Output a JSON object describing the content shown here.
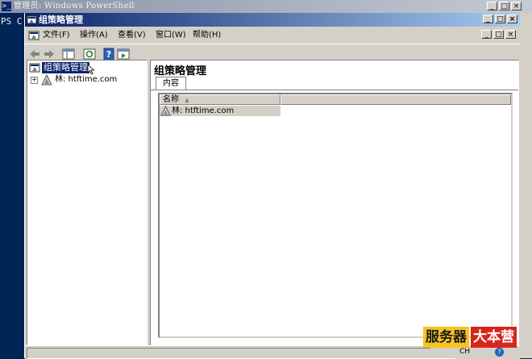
{
  "background_window": {
    "title": "管理员: Windows PowerShell",
    "prompt": "PS C"
  },
  "window": {
    "title": "组策略管理",
    "controls": [
      "_",
      "□",
      "×"
    ]
  },
  "menu": {
    "items": [
      "文件(F)",
      "操作(A)",
      "查看(V)",
      "窗口(W)",
      "帮助(H)"
    ],
    "mdi_controls": [
      "_",
      "□",
      "×"
    ]
  },
  "toolbar": {
    "icons": [
      "back-icon",
      "forward-icon",
      "show-hide-tree-icon",
      "refresh-icon",
      "help-icon",
      "properties-icon"
    ]
  },
  "tree": {
    "root_label": "组策略管理",
    "forest_label": "林: htftime.com"
  },
  "content": {
    "heading": "组策略管理",
    "tab_label": "内容",
    "columns": [
      "名称"
    ],
    "rows": [
      {
        "name": "林: htftime.com"
      }
    ]
  },
  "taskbar": {
    "language": "CH"
  },
  "watermark": {
    "part1": "服务器",
    "part2": "大本营"
  },
  "colors": {
    "title_active": "#0a246a",
    "selection": "#0a246a",
    "chrome": "#d4d0c8",
    "ps_bg": "#012456"
  }
}
